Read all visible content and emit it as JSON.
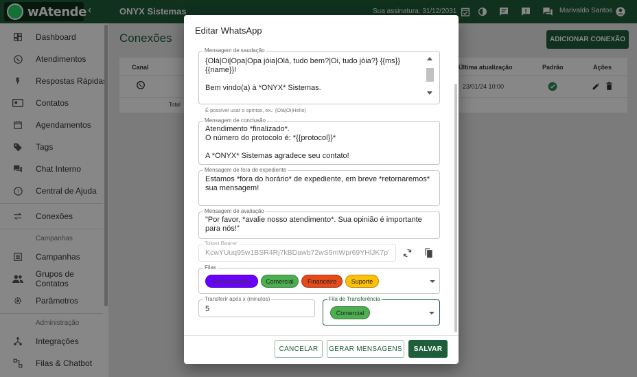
{
  "colors": {
    "brand": "#1f5e3a",
    "accent": "#25d366"
  },
  "brand": {
    "name": "wAtende",
    "logo_icon": "whatsapp-icon",
    "collapse_icon": "chevron-left-icon"
  },
  "topbar": {
    "title": "ONYX Sistemas",
    "subscription": "Sua assinatura: 31/12/2031",
    "user_name": "Marivaldo Santos",
    "icons": [
      "calendar-check-icon",
      "theme-toggle-icon",
      "chat-icon",
      "alert-chat-icon",
      "forum-icon",
      "account-icon"
    ]
  },
  "sidebar": {
    "items": [
      {
        "label": "Dashboard",
        "icon": "dashboard-icon"
      },
      {
        "label": "Atendimentos",
        "icon": "whatsapp-icon"
      },
      {
        "label": "Respostas Rápidas",
        "icon": "flash-icon"
      },
      {
        "label": "Contatos",
        "icon": "contacts-icon"
      },
      {
        "label": "Agendamentos",
        "icon": "calendar-icon"
      },
      {
        "label": "Tags",
        "icon": "tag-icon"
      },
      {
        "label": "Chat Interno",
        "icon": "forum-icon"
      },
      {
        "label": "Central de Ajuda",
        "icon": "help-icon"
      },
      {
        "label": "Conexões",
        "icon": "swap-icon"
      }
    ],
    "section_campaigns": "Campanhas",
    "campaign_items": [
      {
        "label": "Campanhas",
        "icon": "list-icon"
      },
      {
        "label": "Grupos de Contatos",
        "icon": "people-icon"
      },
      {
        "label": "Parâmetros",
        "icon": "settings-icon"
      }
    ],
    "section_admin": "Administração",
    "admin_items": [
      {
        "label": "Integrações",
        "icon": "integration-icon"
      },
      {
        "label": "Filas & Chatbot",
        "icon": "flow-icon"
      }
    ]
  },
  "page": {
    "title": "Conexões",
    "add_button": "ADICIONAR CONEXÃO",
    "columns": {
      "channel": "Canal",
      "last_update": "Última atualização",
      "default": "Padrão",
      "actions": "Ações"
    },
    "row": {
      "channel_icon": "whatsapp-icon",
      "last_update": "23/01/24 10:00",
      "default_icon": "check-circle-icon",
      "edit_icon": "edit-icon",
      "delete_icon": "delete-icon"
    },
    "footer_label": "Total"
  },
  "dialog": {
    "title": "Editar WhatsApp",
    "greeting": {
      "label": "Mensagem de saudação",
      "value": "{Olá|Oi|Opa|Opa jóia|Olá, tudo bem?|Oi, tudo jóia?} {{ms}}\n{{name}}!\n\nBem vindo(a) à *ONYX* Sistemas.",
      "helper": "É possível usar o spintax, ex.: {Olá|Oi|Hello}"
    },
    "completion": {
      "label": "Mensagem de conclusão",
      "value": "Atendimento *finalizado*.\nO número do protocolo é: *{{protocol}}*\n\nA *ONYX* Sistemas agradece seu contato!"
    },
    "out_of_hours": {
      "label": "Mensagem de fora de expediente",
      "value": "Estamos *fora do horário* de expediente, em breve *retornaremos*\nsua mensagem!"
    },
    "rating": {
      "label": "Mensagem de avaliação",
      "value": "\"Por favor, *avalie nosso atendimento*. Sua opinião é importante\npara nós!\""
    },
    "token": {
      "label": "Token Bearer",
      "value": "KcwYUuq95w1BSR4Rj7kBDawb72wS9mWpr69YHlJK7p'",
      "refresh_icon": "refresh-icon",
      "copy_icon": "copy-icon"
    },
    "queues": {
      "label": "Filas",
      "chips": [
        {
          "label": "Administrativo",
          "color": "#6a00ff"
        },
        {
          "label": "Comercial",
          "color": "#4caf50"
        },
        {
          "label": "Financeiro",
          "color": "#e64a19"
        },
        {
          "label": "Suporte",
          "color": "#ffc107"
        }
      ]
    },
    "transfer_after": {
      "label": "Transferir após x (minutos)",
      "value": "5"
    },
    "transfer_queue": {
      "label": "Fila de Transferência",
      "chip": {
        "label": "Comercial",
        "color": "#4caf50"
      }
    },
    "buttons": {
      "cancel": "CANCELAR",
      "generate": "GERAR MENSAGENS",
      "save": "SALVAR"
    }
  }
}
